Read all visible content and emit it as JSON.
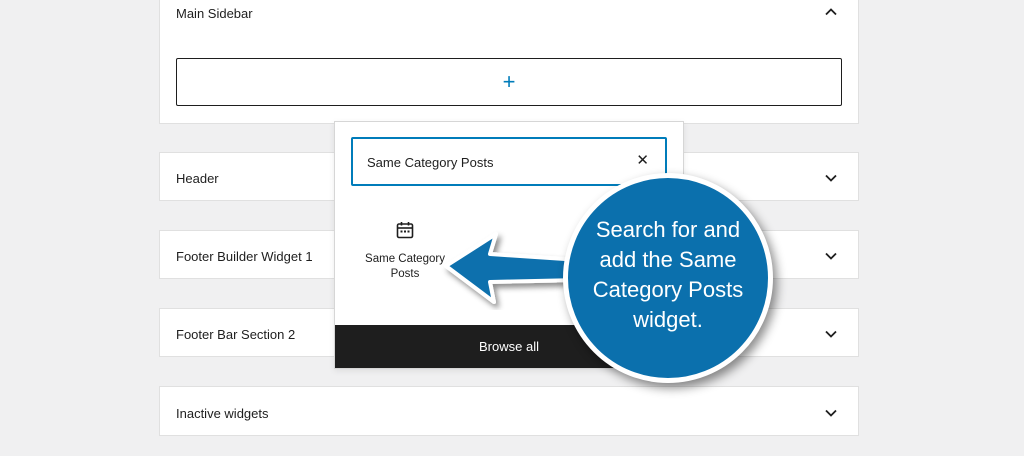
{
  "panels": {
    "main_sidebar": {
      "title": "Main Sidebar",
      "add_symbol": "+"
    },
    "header": {
      "title": "Header"
    },
    "footer_builder": {
      "title": "Footer Builder Widget 1"
    },
    "footer_bar": {
      "title": "Footer Bar Section 2"
    },
    "inactive": {
      "title": "Inactive widgets"
    }
  },
  "inserter": {
    "search_value": "Same Category Posts",
    "clear_symbol": "✕",
    "result_label": "Same Category Posts",
    "result_icon": "calendar-icon",
    "browse_all": "Browse all"
  },
  "callout": {
    "text": "Search for and add the Same Category Posts widget.",
    "color": "#0b70ad"
  },
  "colors": {
    "accent": "#007cba",
    "dark": "#1e1e1e",
    "background": "#f0f0f1"
  }
}
